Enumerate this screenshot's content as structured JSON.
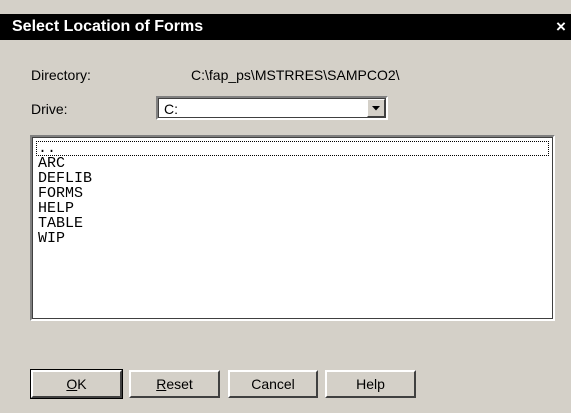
{
  "dialog": {
    "title": "Select Location of Forms",
    "close_glyph": "×"
  },
  "directory": {
    "label": "Directory:",
    "value": "C:\\fap_ps\\MSTRRES\\SAMPCO2\\"
  },
  "drive": {
    "label": "Drive:",
    "value": "C:"
  },
  "folders": [
    "..",
    "ARC",
    "DEFLIB",
    "FORMS",
    "HELP",
    "TABLE",
    "WIP"
  ],
  "buttons": {
    "ok": {
      "mnemonic": "O",
      "rest": "K"
    },
    "reset": {
      "mnemonic": "R",
      "rest": "eset"
    },
    "cancel": "Cancel",
    "help": "Help"
  },
  "colors": {
    "titlebar_bg": "#000000",
    "dialog_bg": "#d4d0c8"
  }
}
